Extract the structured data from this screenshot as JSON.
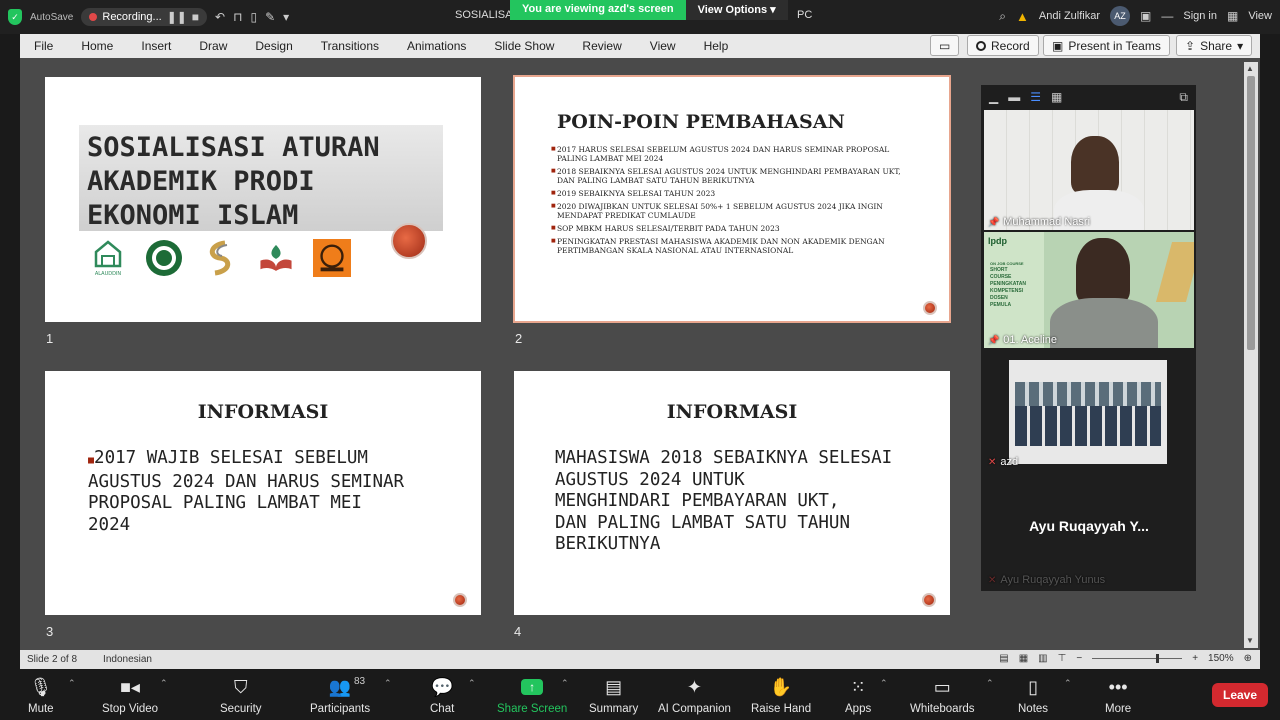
{
  "titlebar": {
    "autosave_label": "AutoSave",
    "recording_label": "Recording...",
    "doc_title": "SOSIALISAS",
    "doc_title_suffix": "PC",
    "viewing_banner": "You are viewing azd's screen",
    "view_options": "View Options",
    "user_name": "Andi Zulfikar",
    "user_initials": "AZ",
    "sign_in": "Sign in",
    "view_label": "View"
  },
  "ribbon": {
    "tabs": [
      "File",
      "Home",
      "Insert",
      "Draw",
      "Design",
      "Transitions",
      "Animations",
      "Slide Show",
      "Review",
      "View",
      "Help"
    ],
    "record": "Record",
    "present_teams": "Present in Teams",
    "share": "Share"
  },
  "slides": {
    "s1": {
      "number": "1",
      "title_lines": [
        "SOSIALISASI ATURAN",
        "AKADEMIK PRODI",
        "EKONOMI ISLAM"
      ],
      "logo_caption": "ALAUDDIN"
    },
    "s2": {
      "number": "2",
      "title": "POIN-POIN PEMBAHASAN",
      "items": [
        "2017 HARUS SELESAI SEBELUM AGUSTUS 2024 DAN HARUS SEMINAR PROPOSAL PALING LAMBAT MEI 2024",
        "2018 SEBAIKNYA SELESAI AGUSTUS 2024 UNTUK MENGHINDARI PEMBAYARAN UKT, DAN PALING LAMBAT SATU TAHUN BERIKUTNYA",
        "2019 SEBAIKNYA SELESAI TAHUN 2023",
        "2020 DIWAJIBKAN UNTUK SELESAI 50%+ 1 SEBELUM AGUSTUS 2024 JIKA INGIN MENDAPAT PREDIKAT CUMLAUDE",
        "SOP MBKM HARUS SELESAI/TERBIT PADA TAHUN 2023",
        "PENINGKATAN PRESTASI MAHASISWA AKADEMIK DAN NON AKADEMIK DENGAN PERTIMBANGAN SKALA NASIONAL ATAU INTERNASIONAL"
      ]
    },
    "s3": {
      "number": "3",
      "title": "INFORMASI",
      "body_lines": [
        "2017 WAJIB SELESAI SEBELUM",
        "AGUSTUS 2024 DAN HARUS SEMINAR",
        "PROPOSAL PALING LAMBAT MEI",
        "2024"
      ]
    },
    "s4": {
      "number": "4",
      "title": "INFORMASI",
      "body_lines": [
        "MAHASISWA 2018 SEBAIKNYA SELESAI",
        "AGUSTUS 2024 UNTUK",
        "MENGHINDARI PEMBAYARAN UKT,",
        "DAN PALING LAMBAT SATU TAHUN",
        "BERIKUTNYA"
      ]
    }
  },
  "participants_panel": {
    "p1": "Muhammad Nasri",
    "p2": "01. Aceline",
    "p2_banner": {
      "brand": "lpdp",
      "small": "ON JOB COURSE",
      "lines": [
        "SHORT",
        "COURSE",
        "PENINGKATAN",
        "KOMPETENSI",
        "DOSEN",
        "PEMULA"
      ]
    },
    "p3": "azd",
    "p4": "Ayu Ruqayyah Y...",
    "p4_sub": "Ayu Ruqayyah Yunus"
  },
  "statusbar": {
    "slide_info": "Slide 2 of 8",
    "language": "Indonesian",
    "zoom": "150%"
  },
  "controls": {
    "mute": "Mute",
    "stop_video": "Stop Video",
    "security": "Security",
    "participants": "Participants",
    "participants_count": "83",
    "chat": "Chat",
    "share_screen": "Share Screen",
    "summary": "Summary",
    "ai_companion": "AI Companion",
    "raise_hand": "Raise Hand",
    "apps": "Apps",
    "whiteboards": "Whiteboards",
    "notes": "Notes",
    "more": "More",
    "leave": "Leave"
  },
  "colors": {
    "accent_green": "#23c55e",
    "leave_red": "#d3292f",
    "slide_dot": "#a0250e"
  }
}
